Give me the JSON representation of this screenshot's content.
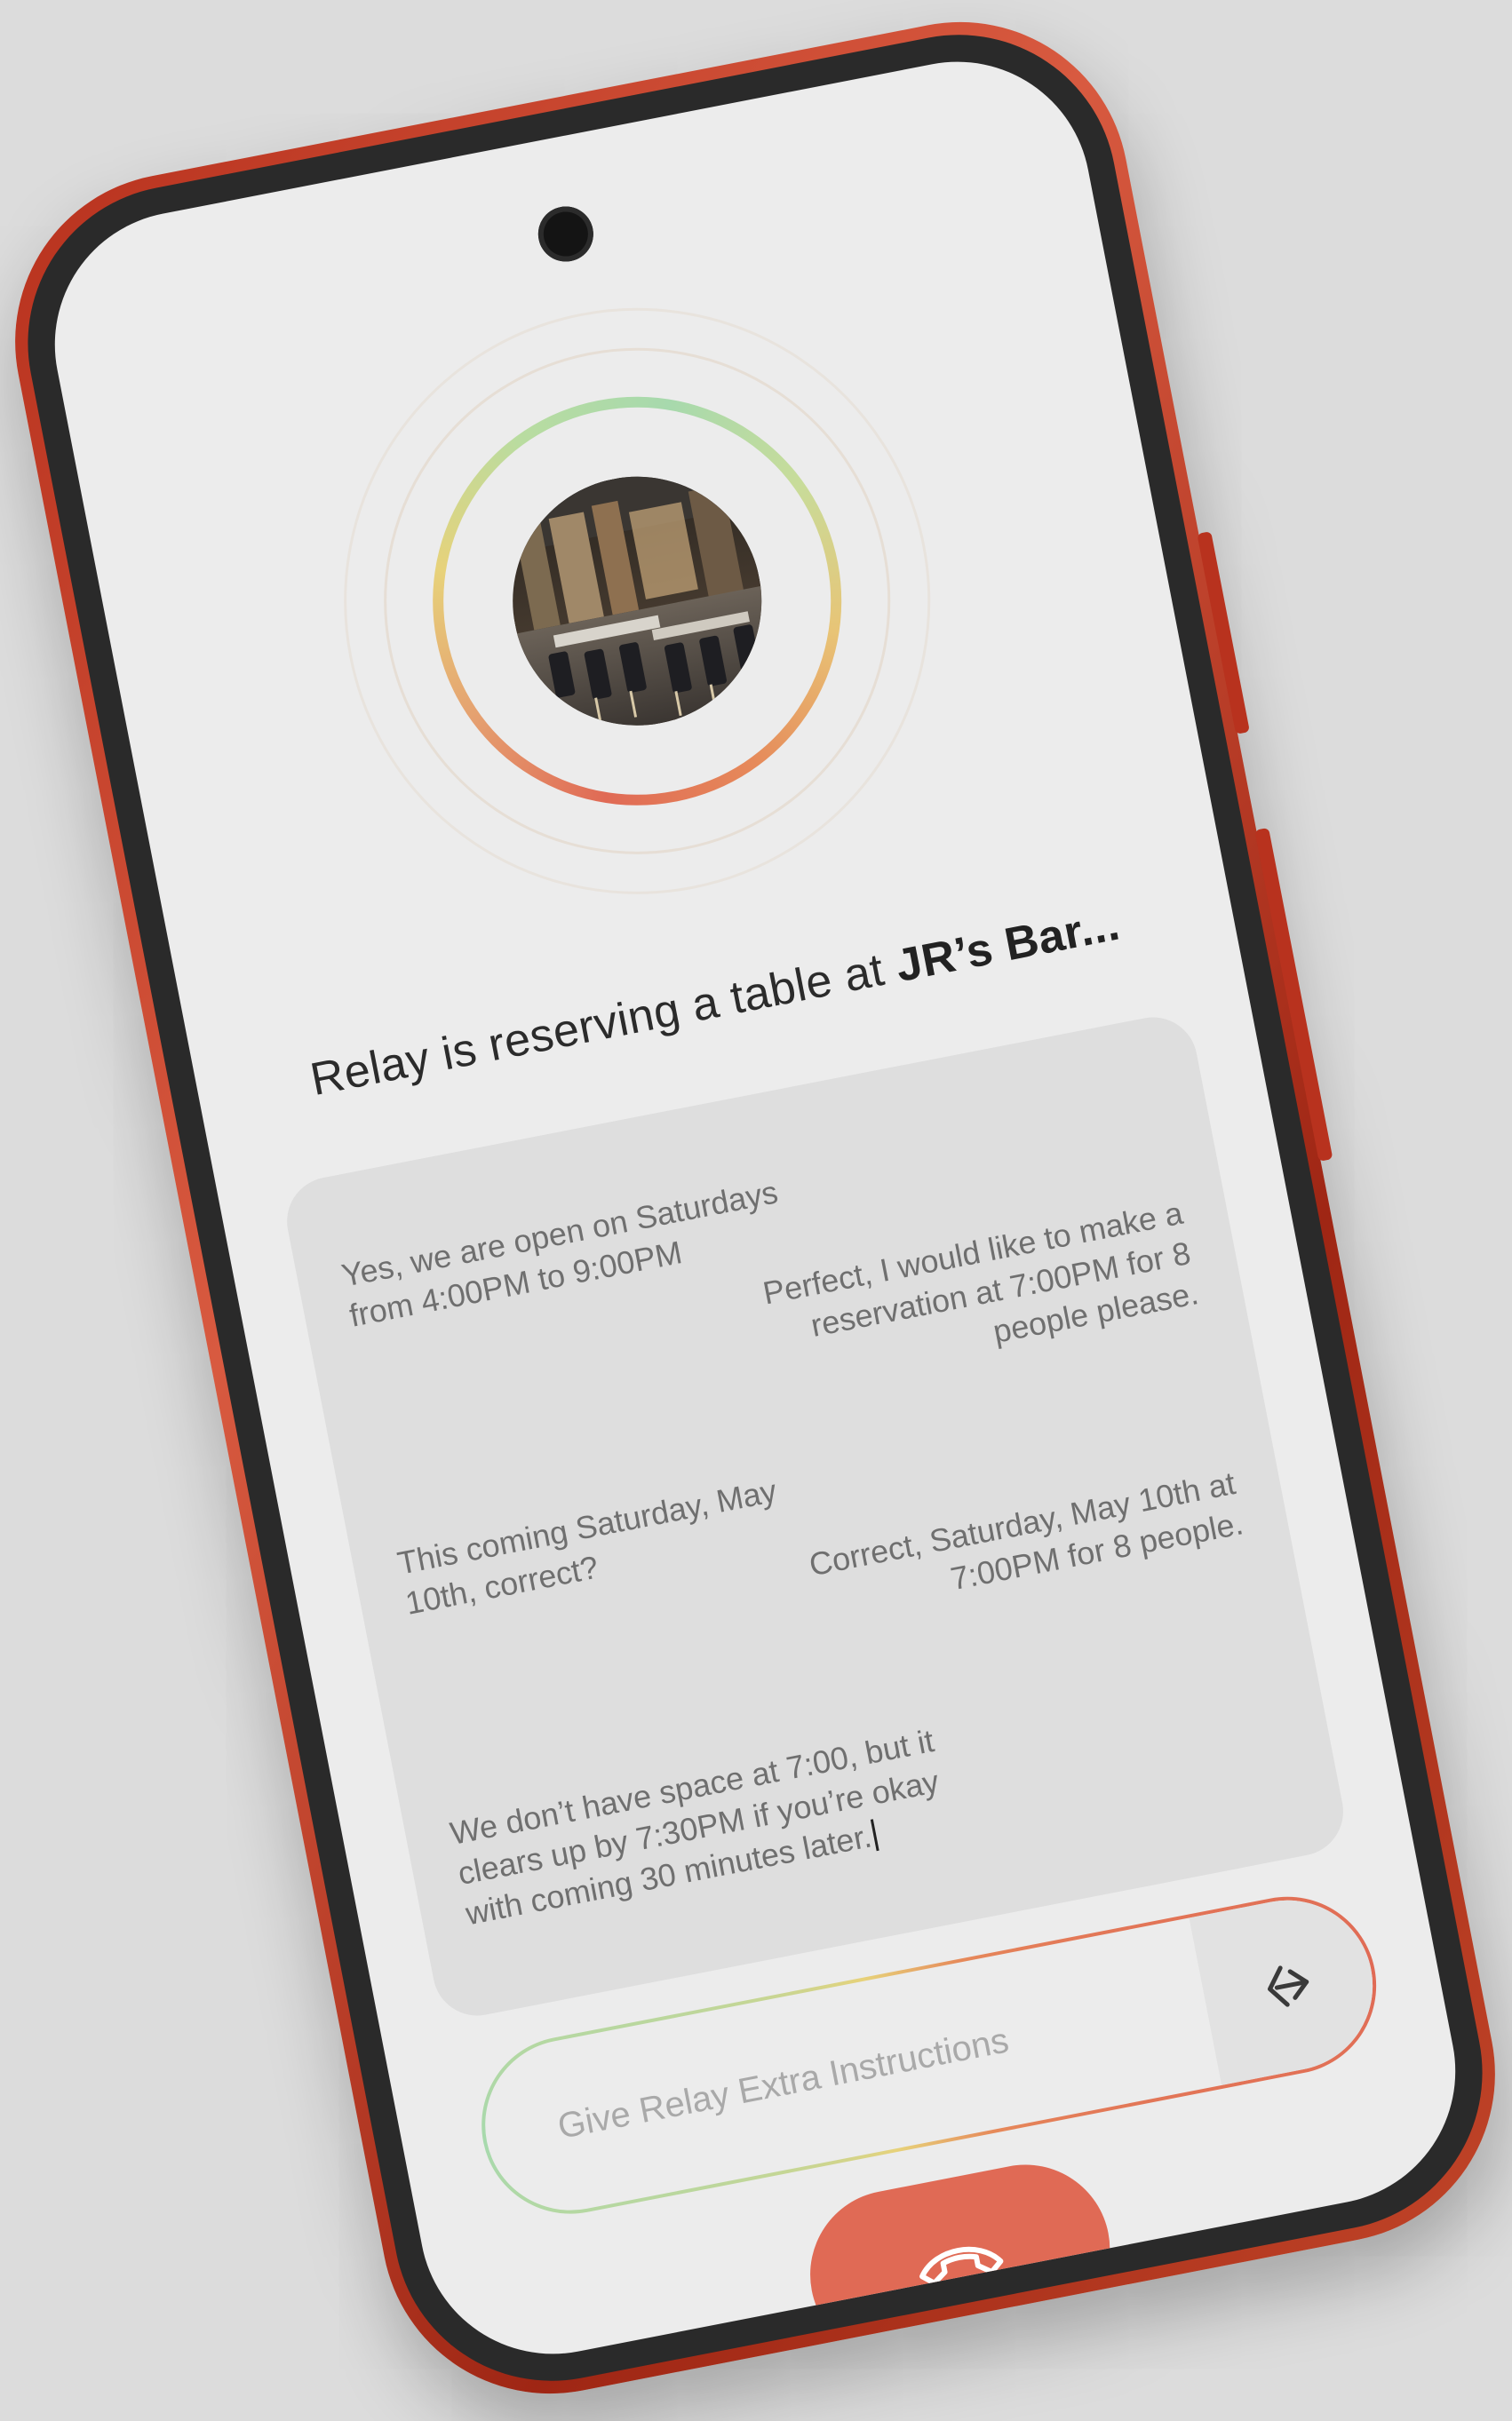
{
  "status": {
    "prefix": "Relay is reserving a table at ",
    "venue": "JR’s Bar..."
  },
  "transcript": {
    "messages": [
      {
        "side": "left",
        "text": "Yes, we are open on Saturdays from 4:00PM to 9:00PM"
      },
      {
        "side": "right",
        "text": "Perfect, I would like to make a reservation at 7:00PM for 8 people please."
      },
      {
        "side": "left",
        "text": "This coming Saturday, May 10th, correct?"
      },
      {
        "side": "right",
        "text": "Correct, Saturday, May 10th at 7:00PM for 8 people."
      },
      {
        "side": "left",
        "text": "We don’t have space at 7:00, but it clears up by 7:30PM if you’re okay with coming 30 minutes later."
      }
    ]
  },
  "instructions": {
    "placeholder": "Give Relay Extra Instructions",
    "value": ""
  },
  "icons": {
    "send": "send-arrow-icon",
    "end_call": "phone-hangup-icon",
    "avatar": "restaurant-photo"
  },
  "colors": {
    "accent_red": "#e06a55",
    "ring_green": "#a7d9ad",
    "ring_yellow": "#e7d27a",
    "ring_orange": "#e68a5a",
    "frame_red": "#b8321e"
  }
}
